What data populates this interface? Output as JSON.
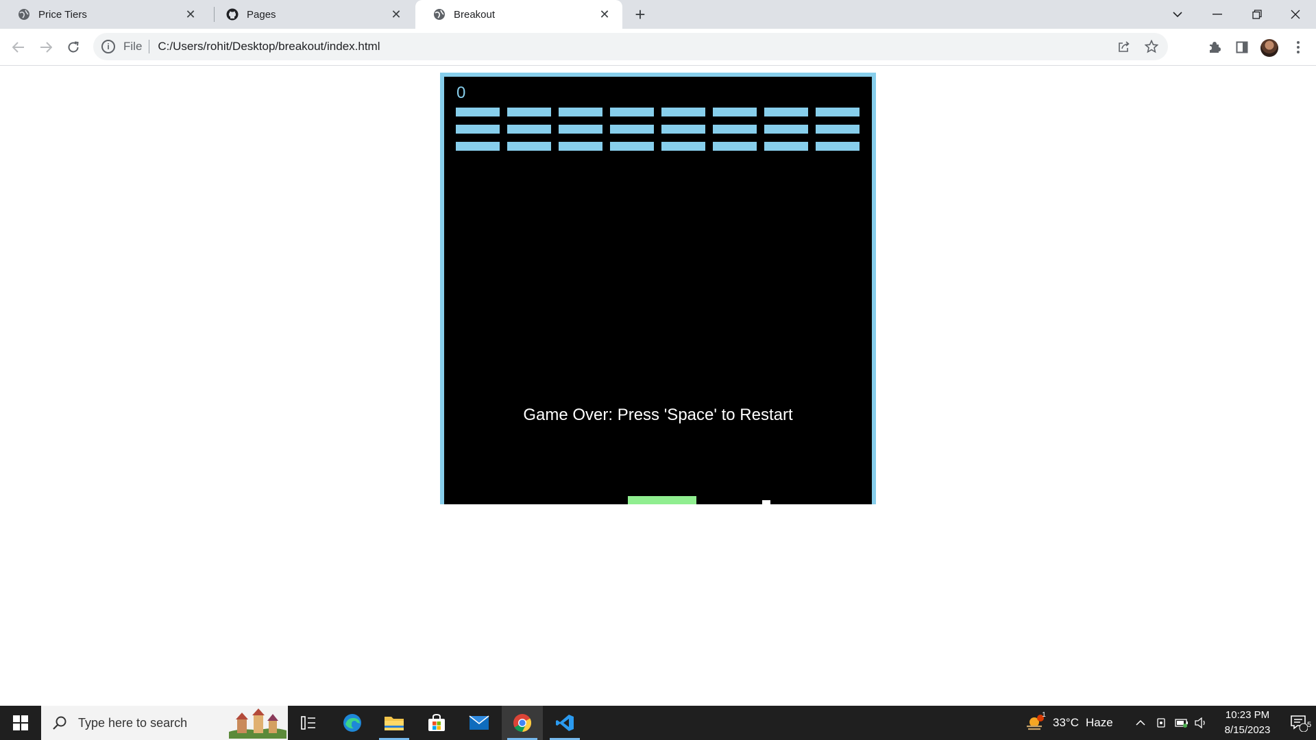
{
  "browser": {
    "tabs": [
      {
        "title": "Price Tiers",
        "favicon": "globe-icon",
        "active": false
      },
      {
        "title": "Pages",
        "favicon": "github-icon",
        "active": false
      },
      {
        "title": "Breakout",
        "favicon": "globe-icon",
        "active": true
      }
    ],
    "address": {
      "scheme_label": "File",
      "url": "C:/Users/rohit/Desktop/breakout/index.html"
    }
  },
  "game": {
    "score": "0",
    "message": "Game Over: Press 'Space' to Restart",
    "brick_rows": 3,
    "brick_cols": 8,
    "colors": {
      "background": "#000000",
      "border": "#87ceeb",
      "brick": "#87ceeb",
      "paddle": "#90ee90",
      "ball": "#ffffff",
      "text": "#ffffff"
    }
  },
  "taskbar": {
    "search_placeholder": "Type here to search",
    "apps": [
      "task-view-icon",
      "edge-icon",
      "file-explorer-icon",
      "store-icon",
      "mail-icon",
      "chrome-icon",
      "vscode-icon"
    ],
    "weather": {
      "temp": "33°C",
      "condition": "Haze",
      "badge": "1"
    },
    "clock": {
      "time": "10:23 PM",
      "date": "8/15/2023"
    },
    "notifications": "5"
  }
}
